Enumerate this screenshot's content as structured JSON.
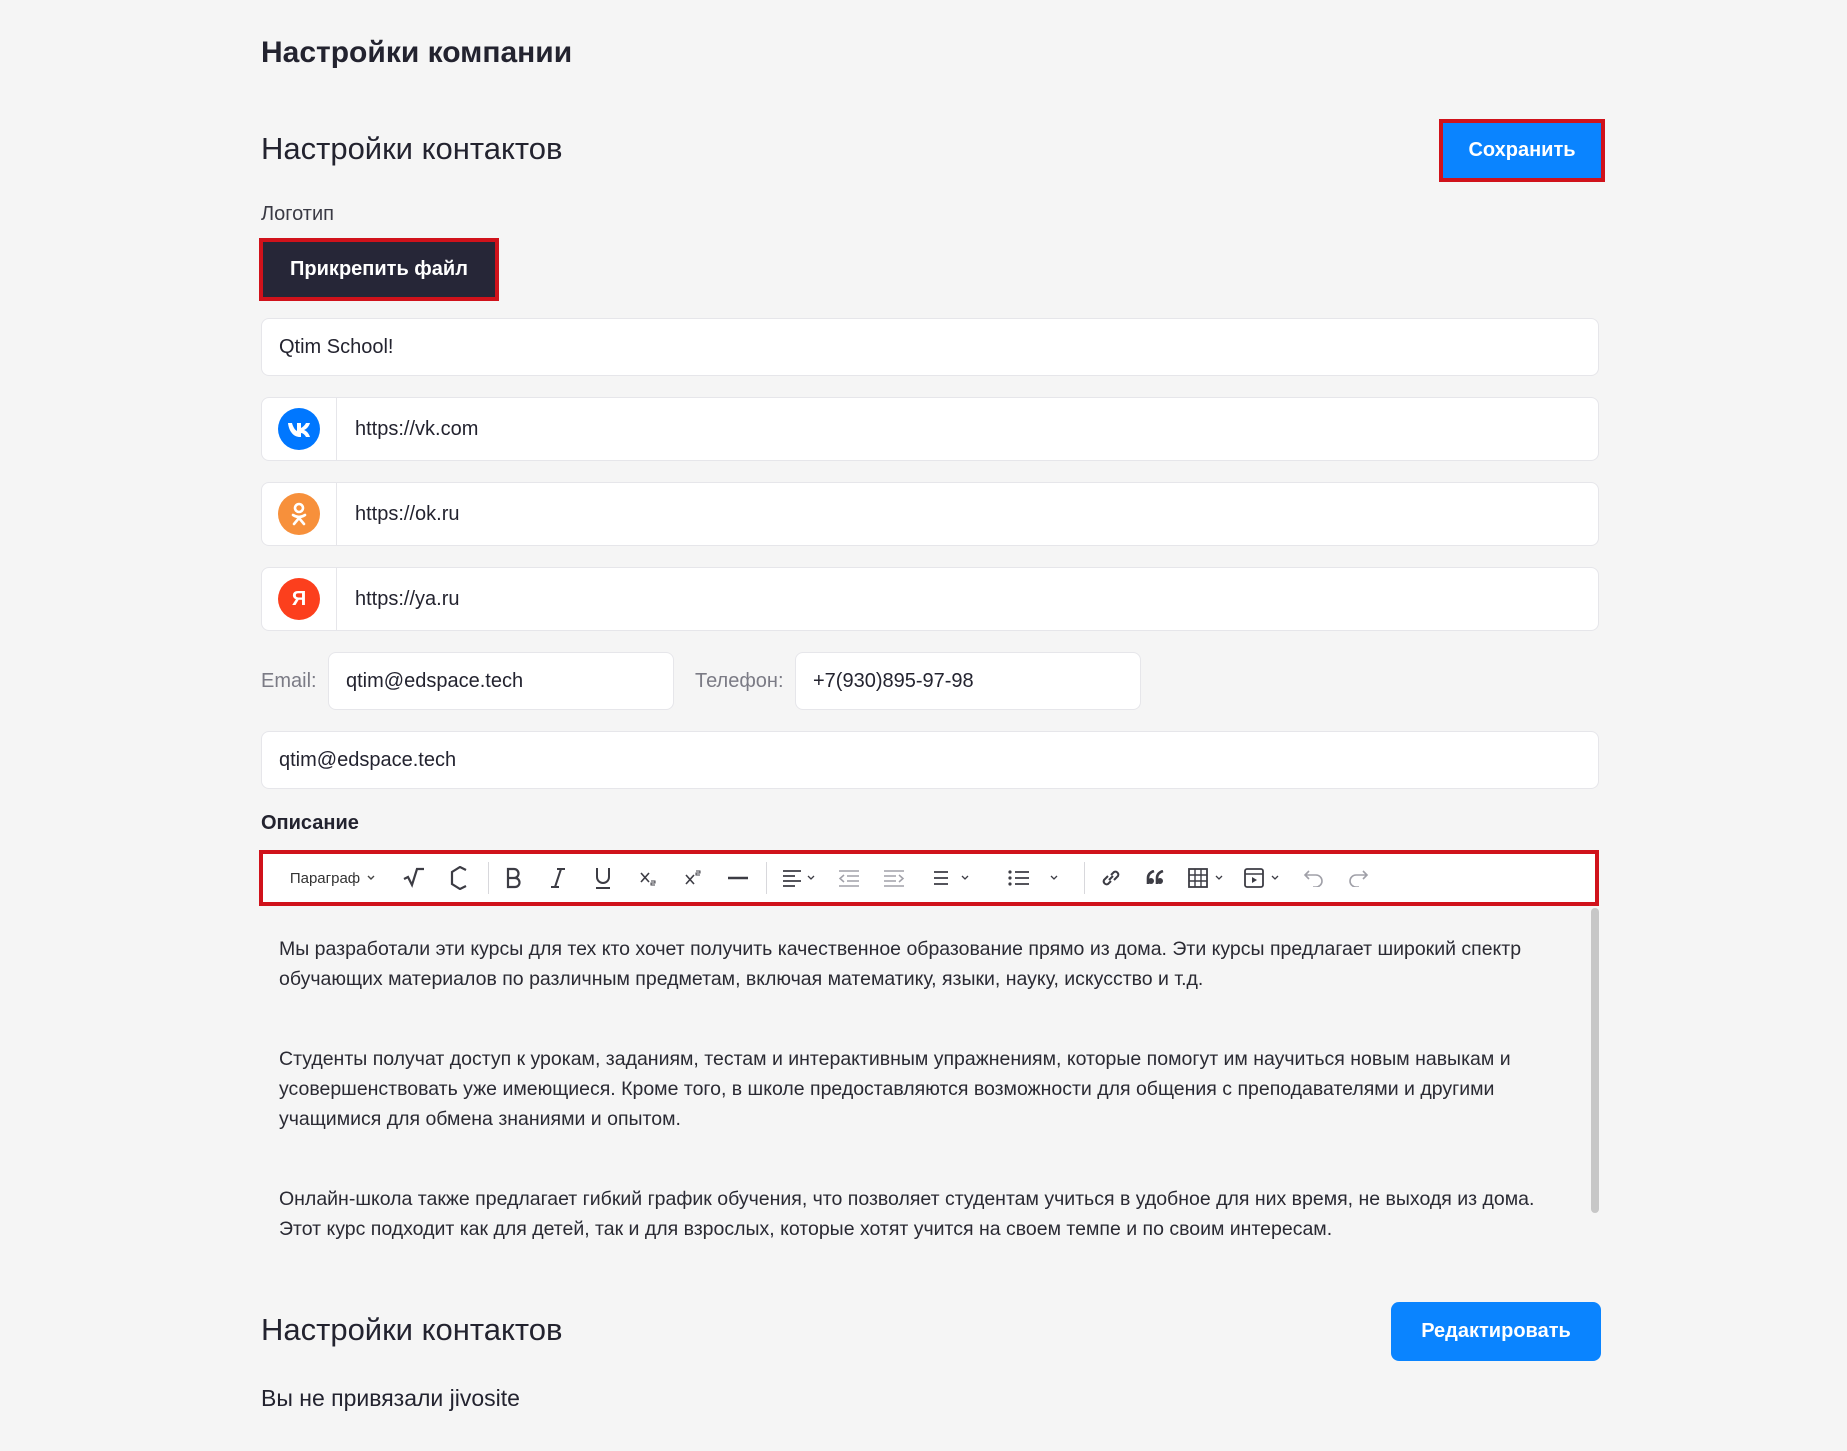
{
  "page_title": "Настройки компании",
  "contacts_section": {
    "title": "Настройки контактов",
    "save_label": "Сохранить",
    "logo_label": "Логотип",
    "attach_label": "Прикрепить файл",
    "company_name": "Qtim School!",
    "socials": [
      {
        "icon": "vk-icon",
        "color": "#0077ff",
        "glyph": "vk",
        "url": "https://vk.com"
      },
      {
        "icon": "odnoklassniki-icon",
        "color": "#f7903b",
        "glyph": "ok",
        "url": "https://ok.ru"
      },
      {
        "icon": "yandex-icon",
        "color": "#fc3f1d",
        "glyph": "Я",
        "url": "https://ya.ru"
      }
    ],
    "email_label": "Email:",
    "email_value": "qtim@edspace.tech",
    "phone_label": "Телефон:",
    "phone_value": "+7(930)895-97-98",
    "extra_email": "qtim@edspace.tech"
  },
  "description": {
    "label": "Описание",
    "toolbar": {
      "paragraph_select": "Параграф",
      "tools": [
        "paragraph-select",
        "math-icon",
        "chemistry-icon",
        "bold-icon",
        "italic-icon",
        "underline-icon",
        "subscript-icon",
        "superscript-icon",
        "horizontal-line-icon",
        "align-icon",
        "outdent-icon",
        "indent-icon",
        "line-height-icon",
        "bulleted-list-icon",
        "link-icon",
        "quote-icon",
        "table-icon",
        "media-icon",
        "undo-icon",
        "redo-icon"
      ]
    },
    "paragraphs": [
      "Мы разработали эти курсы для тех кто хочет получить качественное образование прямо из дома. Эти курсы предлагает широкий спектр обучающих материалов по различным предметам, включая математику, языки, науку, искусство и т.д.",
      "Студенты получат доступ к урокам, заданиям, тестам и интерактивным упражнениям, которые помогут им научиться новым навыкам и усовершенствовать уже имеющиеся. Кроме того, в школе предоставляются возможности для общения с преподавателями и другими учащимися для обмена знаниями и опытом.",
      "Онлайн-школа также предлагает гибкий график обучения, что позволяет студентам учиться в удобное для них время, не выходя из дома. Этот курс подходит как для детей, так и для взрослых, которые хотят учится на своем темпе и по своим интересам."
    ]
  },
  "chat_section": {
    "title": "Настройки контактов",
    "edit_label": "Редактировать",
    "status_text": "Вы не привязали jivosite"
  },
  "colors": {
    "accent": "#0a84ff",
    "dark_button": "#262637",
    "highlight_outline": "#d0121b",
    "background": "#f5f5f5"
  }
}
